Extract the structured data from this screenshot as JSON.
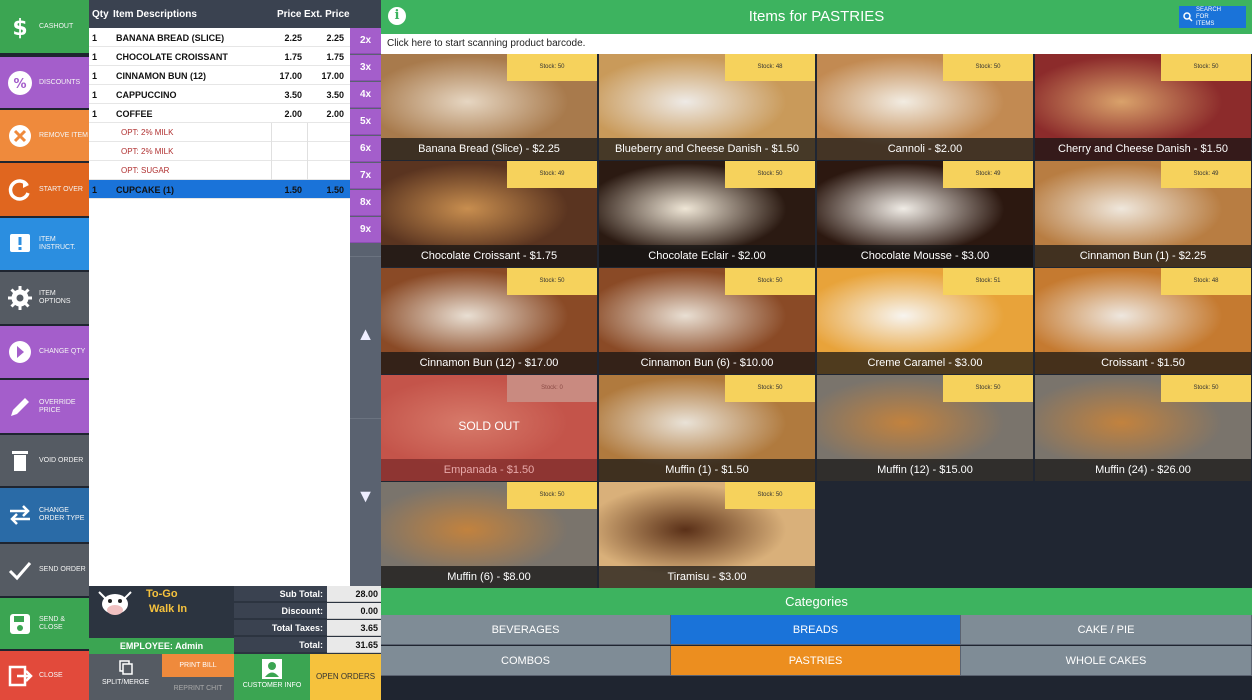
{
  "actions": [
    {
      "label": "CASHOUT",
      "icon": "dollar-icon",
      "color": "#3ba552"
    },
    {
      "label": "DISCOUNTS",
      "icon": "percent-icon",
      "color": "#a45ecb"
    },
    {
      "label": "REMOVE ITEM",
      "icon": "remove-icon",
      "color": "#ef8a3c"
    },
    {
      "label": "START OVER",
      "icon": "restart-icon",
      "color": "#e0661f"
    },
    {
      "label": "ITEM INSTRUCT.",
      "icon": "instruction-icon",
      "color": "#2b8ee0"
    },
    {
      "label": "ITEM OPTIONS",
      "icon": "gear-icon",
      "color": "#555b63"
    },
    {
      "label": "CHANGE QTY",
      "icon": "change-qty-icon",
      "color": "#a45ecb"
    },
    {
      "label": "OVERRIDE PRICE",
      "icon": "pencil-icon",
      "color": "#a45ecb"
    },
    {
      "label": "VOID ORDER",
      "icon": "trash-icon",
      "color": "#555b63"
    },
    {
      "label": "CHANGE ORDER TYPE",
      "icon": "swap-icon",
      "color": "#2a6ba7"
    },
    {
      "label": "SEND ORDER",
      "icon": "check-icon",
      "color": "#555b63"
    },
    {
      "label": "SEND & CLOSE",
      "icon": "save-icon",
      "color": "#3ba552"
    },
    {
      "label": "CLOSE",
      "icon": "exit-icon",
      "color": "#e24a3b"
    }
  ],
  "order": {
    "headers": {
      "qty": "Qty",
      "desc": "Item Descriptions",
      "price": "Price",
      "ext": "Ext. Price"
    },
    "rows": [
      {
        "qty": "1",
        "desc": "BANANA BREAD (SLICE)",
        "price": "2.25",
        "ext": "2.25"
      },
      {
        "qty": "1",
        "desc": "CHOCOLATE CROISSANT",
        "price": "1.75",
        "ext": "1.75"
      },
      {
        "qty": "1",
        "desc": "CINNAMON BUN (12)",
        "price": "17.00",
        "ext": "17.00"
      },
      {
        "qty": "1",
        "desc": "CAPPUCCINO",
        "price": "3.50",
        "ext": "3.50"
      },
      {
        "qty": "1",
        "desc": "COFFEE",
        "price": "2.00",
        "ext": "2.00"
      },
      {
        "opt": "OPT: 2% MILK"
      },
      {
        "opt": "OPT: 2% MILK"
      },
      {
        "opt": "OPT: SUGAR"
      },
      {
        "qty": "1",
        "desc": "CUPCAKE (1)",
        "price": "1.50",
        "ext": "1.50",
        "selected": true
      }
    ]
  },
  "multipliers": [
    "2x",
    "3x",
    "4x",
    "5x",
    "6x",
    "7x",
    "8x",
    "9x"
  ],
  "arrows": {
    "up": "▲",
    "down": "▼"
  },
  "ordertype": {
    "type": "To-Go",
    "sub": "Walk In"
  },
  "totals": [
    {
      "label": "Sub Total:",
      "value": "28.00"
    },
    {
      "label": "Discount:",
      "value": "0.00"
    },
    {
      "label": "Total Taxes:",
      "value": "3.65"
    },
    {
      "label": "Total:",
      "value": "31.65"
    }
  ],
  "employee": "EMPLOYEE: Admin",
  "bottom_buttons": {
    "split": "SPLIT/MERGE",
    "print_bill": "PRINT BILL",
    "reprint": "REPRINT CHIT",
    "customer": "CUSTOMER INFO",
    "open_orders": "OPEN ORDERS"
  },
  "header": {
    "title": "Items for PASTRIES",
    "search": "SEARCH FOR ITEMS",
    "info_icon": "info-icon"
  },
  "scan_prompt": "Click here to start scanning product barcode.",
  "products": [
    {
      "name": "Banana Bread (Slice) - $2.25",
      "stock": "Stock: 50",
      "bg": "#a87a4c",
      "bg2": "#e6d6c2"
    },
    {
      "name": "Blueberry and Cheese Danish - $1.50",
      "stock": "Stock: 48",
      "bg": "#c99a5a",
      "bg2": "#eeeae6"
    },
    {
      "name": "Cannoli - $2.00",
      "stock": "Stock: 50",
      "bg": "#c28a52",
      "bg2": "#f2ece2"
    },
    {
      "name": "Cherry and Cheese Danish - $1.50",
      "stock": "Stock: 50",
      "bg": "#8c2b2b",
      "bg2": "#d9a26b"
    },
    {
      "name": "Chocolate Croissant - $1.75",
      "stock": "Stock: 49",
      "bg": "#5a3420",
      "bg2": "#c88e4f"
    },
    {
      "name": "Chocolate Eclair - $2.00",
      "stock": "Stock: 50",
      "bg": "#2b1a12",
      "bg2": "#efe6d6"
    },
    {
      "name": "Chocolate Mousse - $3.00",
      "stock": "Stock: 49",
      "bg": "#2c1810",
      "bg2": "#f0ece6"
    },
    {
      "name": "Cinnamon Bun (1) - $2.25",
      "stock": "Stock: 49",
      "bg": "#b87d42",
      "bg2": "#efe7dc"
    },
    {
      "name": "Cinnamon Bun (12) - $17.00",
      "stock": "Stock: 50",
      "bg": "#8a4a26",
      "bg2": "#e9dfd3"
    },
    {
      "name": "Cinnamon Bun (6) - $10.00",
      "stock": "Stock: 50",
      "bg": "#8a4a26",
      "bg2": "#e9dfd3"
    },
    {
      "name": "Creme Caramel - $3.00",
      "stock": "Stock: 51",
      "bg": "#e8a33a",
      "bg2": "#f7f4ef"
    },
    {
      "name": "Croissant - $1.50",
      "stock": "Stock: 48",
      "bg": "#c57a30",
      "bg2": "#eee7df"
    },
    {
      "name": "Empanada - $1.50",
      "stock": "Stock: 0",
      "bg": "#c4544a",
      "bg2": "#d77a6a",
      "sold": true,
      "sold_label": "SOLD OUT"
    },
    {
      "name": "Muffin (1) - $1.50",
      "stock": "Stock: 50",
      "bg": "#b07a3e",
      "bg2": "#e9e2d7"
    },
    {
      "name": "Muffin (12) - $15.00",
      "stock": "Stock: 50",
      "bg": "#7a746c",
      "bg2": "#c2823e"
    },
    {
      "name": "Muffin (24) - $26.00",
      "stock": "Stock: 50",
      "bg": "#7a746c",
      "bg2": "#c2823e"
    },
    {
      "name": "Muffin (6) - $8.00",
      "stock": "Stock: 50",
      "bg": "#7a746c",
      "bg2": "#c2823e"
    },
    {
      "name": "Tiramisu - $3.00",
      "stock": "Stock: 50",
      "bg": "#d9b07a",
      "bg2": "#5a3018"
    }
  ],
  "categories": {
    "title": "Categories",
    "items": [
      {
        "label": "BEVERAGES",
        "color": "#7f8c96"
      },
      {
        "label": "BREADS",
        "color": "#1a73d9"
      },
      {
        "label": "CAKE / PIE",
        "color": "#7f8c96"
      },
      {
        "label": "COMBOS",
        "color": "#7f8c96"
      },
      {
        "label": "PASTRIES",
        "color": "#ec8e1f"
      },
      {
        "label": "WHOLE CAKES",
        "color": "#7f8c96"
      }
    ]
  }
}
